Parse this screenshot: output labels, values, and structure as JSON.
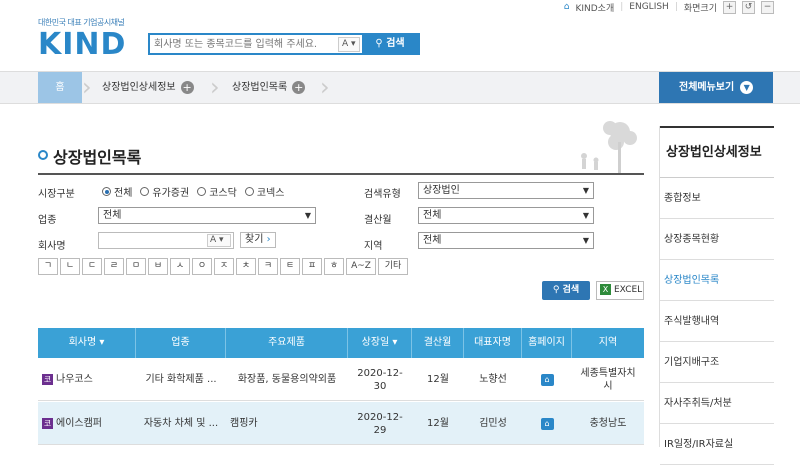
{
  "header": {
    "logo_tagline": "대한민국 대표 기업공시채널",
    "logo_text": "KIND",
    "search_placeholder": "회사명 또는 종목코드를 입력해 주세요.",
    "search_af": "A",
    "search_button": "검색",
    "links": [
      "KIND소개",
      "ENGLISH",
      "화면크기"
    ]
  },
  "nav": {
    "home": "홈",
    "crumbs": [
      "상장법인상세정보",
      "상장법인목록"
    ],
    "all_menu": "전체메뉴보기"
  },
  "page": {
    "title": "상장법인목록"
  },
  "form": {
    "market_label": "시장구분",
    "market_options": [
      "전체",
      "유가증권",
      "코스닥",
      "코넥스"
    ],
    "market_selected": "전체",
    "search_type_label": "검색유형",
    "search_type_value": "상장법인",
    "industry_label": "업종",
    "industry_value": "전체",
    "settle_label": "결산월",
    "settle_value": "전체",
    "company_label": "회사명",
    "company_af": "A",
    "find_button": "찾기",
    "region_label": "지역",
    "region_value": "전체",
    "chosung": [
      "ㄱ",
      "ㄴ",
      "ㄷ",
      "ㄹ",
      "ㅁ",
      "ㅂ",
      "ㅅ",
      "ㅇ",
      "ㅈ",
      "ㅊ",
      "ㅋ",
      "ㅌ",
      "ㅍ",
      "ㅎ",
      "A~Z",
      "기타"
    ],
    "search_button": "검색",
    "excel_button": "EXCEL"
  },
  "table": {
    "headers": [
      "회사명",
      "업종",
      "주요제품",
      "상장일",
      "결산월",
      "대표자명",
      "홈페이지",
      "지역"
    ],
    "rows": [
      {
        "name": "나우코스",
        "industry": "기타 화학제품 ...",
        "product": "화장품, 동물용의약외품",
        "date1": "2020-12-",
        "date2": "30",
        "settle": "12월",
        "ceo": "노향선",
        "region": "세종특별자치시"
      },
      {
        "name": "에이스캠퍼",
        "industry": "자동차 차체 및 ...",
        "product": "캠핑카",
        "date1": "2020-12-",
        "date2": "29",
        "settle": "12월",
        "ceo": "김민성",
        "region": "충청남도"
      }
    ]
  },
  "sidebar": {
    "title": "상장법인상세정보",
    "items": [
      "종합정보",
      "상장종목현황",
      "상장법인목록",
      "주식발행내역",
      "기업지배구조",
      "자사주취득/처분",
      "IR일정/IR자료실"
    ],
    "active_index": 2
  },
  "colors": {
    "brand": "#2a87c8",
    "header_row": "#3aa1d6",
    "alt_row": "#e3f1f8",
    "nav_dark": "#2e76b3"
  }
}
